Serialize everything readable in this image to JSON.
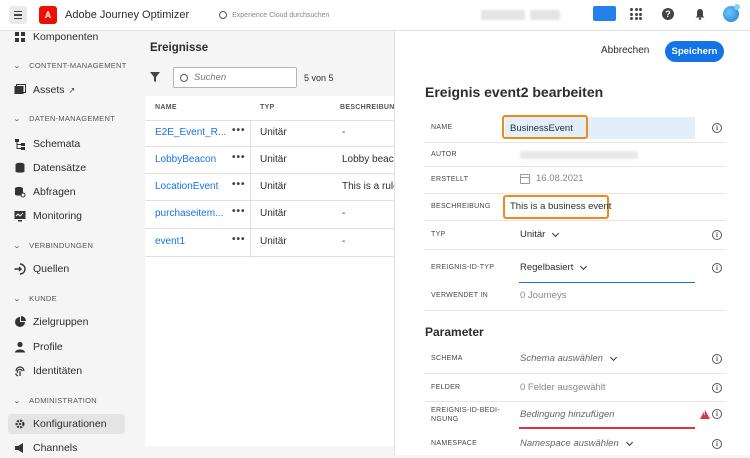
{
  "header": {
    "app_title": "Adobe Journey Optimizer",
    "search_placeholder": "Experience Cloud durchsuchen",
    "help_glyph": "?",
    "logo_letter": "A"
  },
  "sidebar": {
    "items_top": [
      {
        "label": "Komponenten",
        "icon": "components-icon"
      }
    ],
    "sections": [
      {
        "title": "CONTENT-MANAGEMENT",
        "items": [
          {
            "label": "Assets",
            "icon": "assets-icon"
          }
        ]
      },
      {
        "title": "DATEN-MANAGEMENT",
        "items": [
          {
            "label": "Schemata",
            "icon": "schema-icon"
          },
          {
            "label": "Datensätze",
            "icon": "datasets-icon"
          },
          {
            "label": "Abfragen",
            "icon": "queries-icon"
          },
          {
            "label": "Monitoring",
            "icon": "monitoring-icon"
          }
        ]
      },
      {
        "title": "VERBINDUNGEN",
        "items": [
          {
            "label": "Quellen",
            "icon": "sources-icon"
          }
        ]
      },
      {
        "title": "KUNDE",
        "items": [
          {
            "label": "Zielgruppen",
            "icon": "audiences-icon"
          },
          {
            "label": "Profile",
            "icon": "profile-icon"
          },
          {
            "label": "Identitäten",
            "icon": "identities-icon"
          }
        ]
      },
      {
        "title": "ADMINISTRATION",
        "items": [
          {
            "label": "Konfigurationen",
            "icon": "configurations-icon",
            "active": true
          },
          {
            "label": "Channels",
            "icon": "channels-icon"
          }
        ]
      }
    ]
  },
  "events_panel": {
    "title": "Ereignisse",
    "search_placeholder": "Suchen",
    "count": "5 von 5",
    "columns": [
      "NAME",
      "TYP",
      "BESCHREIBUNG"
    ],
    "rows": [
      {
        "name": "E2E_Event_R...",
        "type": "Unitär",
        "description": "-"
      },
      {
        "name": "LobbyBeacon",
        "type": "Unitär",
        "description": "Lobby beacon"
      },
      {
        "name": "LocationEvent",
        "type": "Unitär",
        "description": "This is a rule-b"
      },
      {
        "name": "purchaseitem...",
        "type": "Unitär",
        "description": "-"
      },
      {
        "name": "event1",
        "type": "Unitär",
        "description": "-"
      }
    ],
    "row_menu_glyph": "•••"
  },
  "edit_panel": {
    "cancel_label": "Abbrechen",
    "save_label": "Speichern",
    "title": "Ereignis event2 bearbeiten",
    "fields": {
      "name_label": "NAME",
      "name_value": "BusinessEvent",
      "author_label": "AUTOR",
      "created_label": "ERSTELLT",
      "created_value": "16.08.2021",
      "description_label": "BESCHREIBUNG",
      "description_value": "This is a business event",
      "type_label": "TYP",
      "type_value": "Unitär",
      "id_type_label": "EREIGNIS-ID-TYP",
      "id_type_value": "Regelbasiert",
      "used_in_label": "VERWENDET IN",
      "used_in_value": "0 Journeys"
    },
    "parameters": {
      "title": "Parameter",
      "schema_label": "SCHEMA",
      "schema_value": "Schema auswählen",
      "fields_label": "FELDER",
      "fields_value": "0 Felder ausgewählt",
      "condition_label_1": "EREIGNIS-ID-BEDI-",
      "condition_label_2": "NGUNG",
      "condition_value": "Bedingung hinzufügen",
      "namespace_label": "NAMESPACE",
      "namespace_value": "Namespace auswählen"
    },
    "info_glyph": "i",
    "highlight_color": "#f0891c",
    "accent_color": "#1473e6",
    "error_color": "#d7373f"
  }
}
